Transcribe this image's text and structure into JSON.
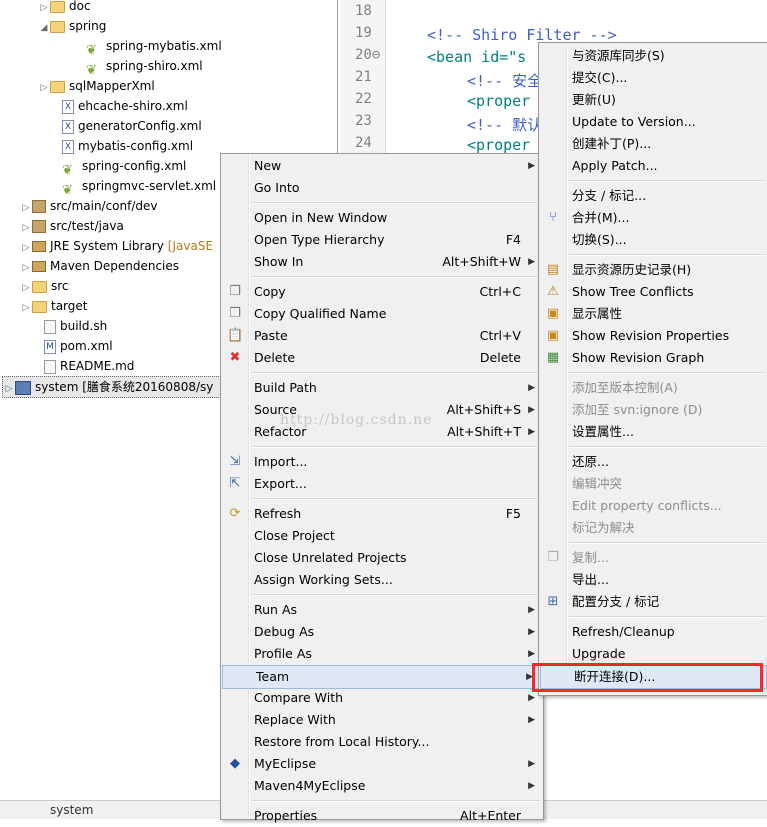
{
  "tree": {
    "items": [
      {
        "label": "doc",
        "arrow": "▷",
        "icon": "folder-icon"
      },
      {
        "label": "spring",
        "arrow": "◢",
        "icon": "folder-icon"
      },
      {
        "label": "spring-mybatis.xml",
        "icon": "spring-leaf-icon"
      },
      {
        "label": "spring-shiro.xml",
        "icon": "spring-leaf-icon"
      },
      {
        "label": "sqlMapperXml",
        "arrow": "▷",
        "icon": "folder-icon"
      },
      {
        "label": "ehcache-shiro.xml",
        "icon": "xml-file-icon"
      },
      {
        "label": "generatorConfig.xml",
        "icon": "xml-file-icon"
      },
      {
        "label": "mybatis-config.xml",
        "icon": "xml-file-icon"
      },
      {
        "label": "spring-config.xml",
        "icon": "spring-leaf-icon"
      },
      {
        "label": "springmvc-servlet.xml",
        "icon": "spring-leaf-icon"
      },
      {
        "label": "src/main/conf/dev",
        "arrow": "▷",
        "icon": "source-folder-icon"
      },
      {
        "label": "src/test/java",
        "arrow": "▷",
        "icon": "source-folder-icon"
      },
      {
        "label": "JRE System Library",
        "suffix": "[JavaSE",
        "arrow": "▷",
        "icon": "library-icon"
      },
      {
        "label": "Maven Dependencies",
        "arrow": "▷",
        "icon": "library-icon"
      },
      {
        "label": "src",
        "arrow": "▷",
        "icon": "folder-icon"
      },
      {
        "label": "target",
        "arrow": "▷",
        "icon": "folder-icon"
      },
      {
        "label": "build.sh",
        "icon": "file-icon"
      },
      {
        "label": "pom.xml",
        "icon": "maven-file-icon"
      },
      {
        "label": "README.md",
        "icon": "file-icon"
      },
      {
        "label": "system [膳食系统20160808/sy",
        "arrow": "▷",
        "icon": "project-icon"
      }
    ]
  },
  "editor": {
    "lines": [
      {
        "n": "18",
        "code": ""
      },
      {
        "n": "19",
        "code": "<!-- Shiro Filter -->"
      },
      {
        "n": "20⊖",
        "code": "<bean id=\"s"
      },
      {
        "n": "21",
        "code": "<!-- 安全"
      },
      {
        "n": "22",
        "code": "<proper"
      },
      {
        "n": "23",
        "code": "<!-- 默认"
      },
      {
        "n": "24",
        "code": "<proper"
      }
    ]
  },
  "status_bar": {
    "text": "system"
  },
  "watermark": "http://blog.csdn.ne",
  "context_menu": {
    "items": [
      {
        "label": "New",
        "submenu": true
      },
      {
        "label": "Go Into"
      },
      {
        "sep": true
      },
      {
        "label": "Open in New Window"
      },
      {
        "label": "Open Type Hierarchy",
        "shortcut": "F4"
      },
      {
        "label": "Show In",
        "shortcut": "Alt+Shift+W",
        "submenu": true
      },
      {
        "sep": true
      },
      {
        "label": "Copy",
        "shortcut": "Ctrl+C",
        "icon": "copy-icon"
      },
      {
        "label": "Copy Qualified Name",
        "icon": "copy-icon"
      },
      {
        "label": "Paste",
        "shortcut": "Ctrl+V",
        "icon": "paste-icon"
      },
      {
        "label": "Delete",
        "shortcut": "Delete",
        "icon": "delete-icon"
      },
      {
        "sep": true
      },
      {
        "label": "Build Path",
        "submenu": true
      },
      {
        "label": "Source",
        "shortcut": "Alt+Shift+S",
        "submenu": true
      },
      {
        "label": "Refactor",
        "shortcut": "Alt+Shift+T",
        "submenu": true
      },
      {
        "sep": true
      },
      {
        "label": "Import...",
        "icon": "import-icon"
      },
      {
        "label": "Export...",
        "icon": "export-icon"
      },
      {
        "sep": true
      },
      {
        "label": "Refresh",
        "shortcut": "F5",
        "icon": "refresh-icon"
      },
      {
        "label": "Close Project"
      },
      {
        "label": "Close Unrelated Projects"
      },
      {
        "label": "Assign Working Sets..."
      },
      {
        "sep": true
      },
      {
        "label": "Run As",
        "submenu": true
      },
      {
        "label": "Debug As",
        "submenu": true
      },
      {
        "label": "Profile As",
        "submenu": true
      },
      {
        "label": "Team",
        "submenu": true,
        "highlighted": true
      },
      {
        "label": "Compare With",
        "submenu": true
      },
      {
        "label": "Replace With",
        "submenu": true
      },
      {
        "label": "Restore from Local History..."
      },
      {
        "label": "MyEclipse",
        "submenu": true,
        "icon": "myeclipse-icon"
      },
      {
        "label": "Maven4MyEclipse",
        "submenu": true
      },
      {
        "sep": true
      },
      {
        "label": "Properties",
        "shortcut": "Alt+Enter"
      }
    ]
  },
  "team_menu": {
    "items": [
      {
        "label": "与资源库同步(S)"
      },
      {
        "label": "提交(C)..."
      },
      {
        "label": "更新(U)"
      },
      {
        "label": "Update to Version..."
      },
      {
        "label": "创建补丁(P)..."
      },
      {
        "label": "Apply Patch..."
      },
      {
        "sep": true
      },
      {
        "label": "分支 / 标记..."
      },
      {
        "label": "合并(M)...",
        "icon": "merge-icon"
      },
      {
        "label": "切换(S)..."
      },
      {
        "sep": true
      },
      {
        "label": "显示资源历史记录(H)",
        "icon": "history-icon"
      },
      {
        "label": "Show Tree Conflicts",
        "icon": "tree-conflicts-icon"
      },
      {
        "label": "显示属性",
        "icon": "properties-icon"
      },
      {
        "label": "Show Revision Properties",
        "icon": "revision-properties-icon"
      },
      {
        "label": "Show Revision Graph",
        "icon": "revision-graph-icon"
      },
      {
        "sep": true
      },
      {
        "label": "添加至版本控制(A)",
        "disabled": true
      },
      {
        "label": "添加至 svn:ignore (D)",
        "disabled": true
      },
      {
        "label": "设置属性..."
      },
      {
        "sep": true
      },
      {
        "label": "还原..."
      },
      {
        "label": "编辑冲突",
        "disabled": true
      },
      {
        "label": "Edit property conflicts...",
        "disabled": true
      },
      {
        "label": "标记为解决",
        "disabled": true
      },
      {
        "sep": true
      },
      {
        "label": "复制...",
        "disabled": true,
        "icon": "copy-icon"
      },
      {
        "label": "导出..."
      },
      {
        "label": "配置分支 / 标记",
        "icon": "branch-config-icon"
      },
      {
        "sep": true
      },
      {
        "label": "Refresh/Cleanup"
      },
      {
        "label": "Upgrade"
      },
      {
        "label": "断开连接(D)...",
        "highlighted": true
      }
    ]
  }
}
